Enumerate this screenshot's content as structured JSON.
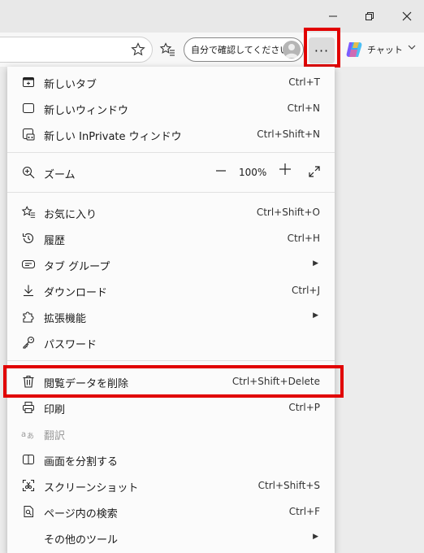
{
  "toolbar": {
    "profile_label": "自分で確認してください",
    "more_label": "···",
    "chat_label": "チャット"
  },
  "menu": {
    "new_tab": {
      "label": "新しいタブ",
      "shortcut": "Ctrl+T"
    },
    "new_window": {
      "label": "新しいウィンドウ",
      "shortcut": "Ctrl+N"
    },
    "new_inprivate": {
      "label": "新しい InPrivate ウィンドウ",
      "shortcut": "Ctrl+Shift+N"
    },
    "zoom": {
      "label": "ズーム",
      "value": "100%"
    },
    "favorites": {
      "label": "お気に入り",
      "shortcut": "Ctrl+Shift+O"
    },
    "history": {
      "label": "履歴",
      "shortcut": "Ctrl+H"
    },
    "tab_groups": {
      "label": "タブ グループ"
    },
    "downloads": {
      "label": "ダウンロード",
      "shortcut": "Ctrl+J"
    },
    "extensions": {
      "label": "拡張機能"
    },
    "passwords": {
      "label": "パスワード"
    },
    "delete_browsing": {
      "label": "閲覧データを削除",
      "shortcut": "Ctrl+Shift+Delete"
    },
    "print": {
      "label": "印刷",
      "shortcut": "Ctrl+P"
    },
    "translate": {
      "label": "翻訳"
    },
    "split_screen": {
      "label": "画面を分割する"
    },
    "screenshot": {
      "label": "スクリーンショット",
      "shortcut": "Ctrl+Shift+S"
    },
    "find_in_page": {
      "label": "ページ内の検索",
      "shortcut": "Ctrl+F"
    },
    "other_tools": {
      "label": "その他のツール"
    }
  },
  "colors": {
    "highlight_box": "#e10000",
    "menu_bg": "#fbfbfb"
  }
}
